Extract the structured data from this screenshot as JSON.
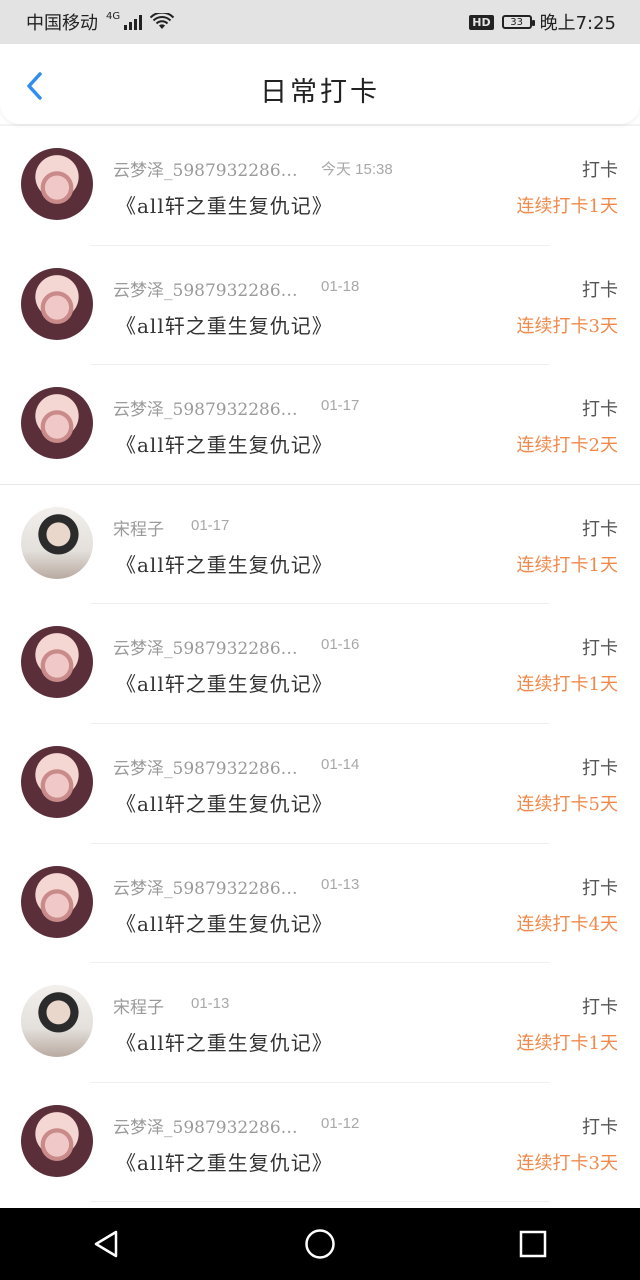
{
  "status_bar": {
    "carrier": "中国移动",
    "network": "4G",
    "time": "晚上7:25",
    "hd_label": "HD",
    "battery": "33"
  },
  "header": {
    "title": "日常打卡"
  },
  "colors": {
    "accent": "#2f8cf0",
    "streak": "#f08a4c"
  },
  "checkins": [
    {
      "avatar": "girl",
      "name": "云梦泽_5987932286…",
      "time": "今天  15:38",
      "book": "《all轩之重生复仇记》",
      "type": "打卡",
      "streak": "连续打卡1天"
    },
    {
      "avatar": "girl",
      "name": "云梦泽_5987932286…",
      "time": "01-18",
      "book": "《all轩之重生复仇记》",
      "type": "打卡",
      "streak": "连续打卡3天"
    },
    {
      "avatar": "girl",
      "name": "云梦泽_5987932286…",
      "time": "01-17",
      "book": "《all轩之重生复仇记》",
      "type": "打卡",
      "streak": "连续打卡2天"
    },
    {
      "avatar": "boy",
      "name": "宋程子",
      "time": "01-17",
      "book": "《all轩之重生复仇记》",
      "type": "打卡",
      "streak": "连续打卡1天"
    },
    {
      "avatar": "girl",
      "name": "云梦泽_5987932286…",
      "time": "01-16",
      "book": "《all轩之重生复仇记》",
      "type": "打卡",
      "streak": "连续打卡1天"
    },
    {
      "avatar": "girl",
      "name": "云梦泽_5987932286…",
      "time": "01-14",
      "book": "《all轩之重生复仇记》",
      "type": "打卡",
      "streak": "连续打卡5天"
    },
    {
      "avatar": "girl",
      "name": "云梦泽_5987932286…",
      "time": "01-13",
      "book": "《all轩之重生复仇记》",
      "type": "打卡",
      "streak": "连续打卡4天"
    },
    {
      "avatar": "boy",
      "name": "宋程子",
      "time": "01-13",
      "book": "《all轩之重生复仇记》",
      "type": "打卡",
      "streak": "连续打卡1天"
    },
    {
      "avatar": "girl",
      "name": "云梦泽_5987932286…",
      "time": "01-12",
      "book": "《all轩之重生复仇记》",
      "type": "打卡",
      "streak": "连续打卡3天"
    }
  ]
}
